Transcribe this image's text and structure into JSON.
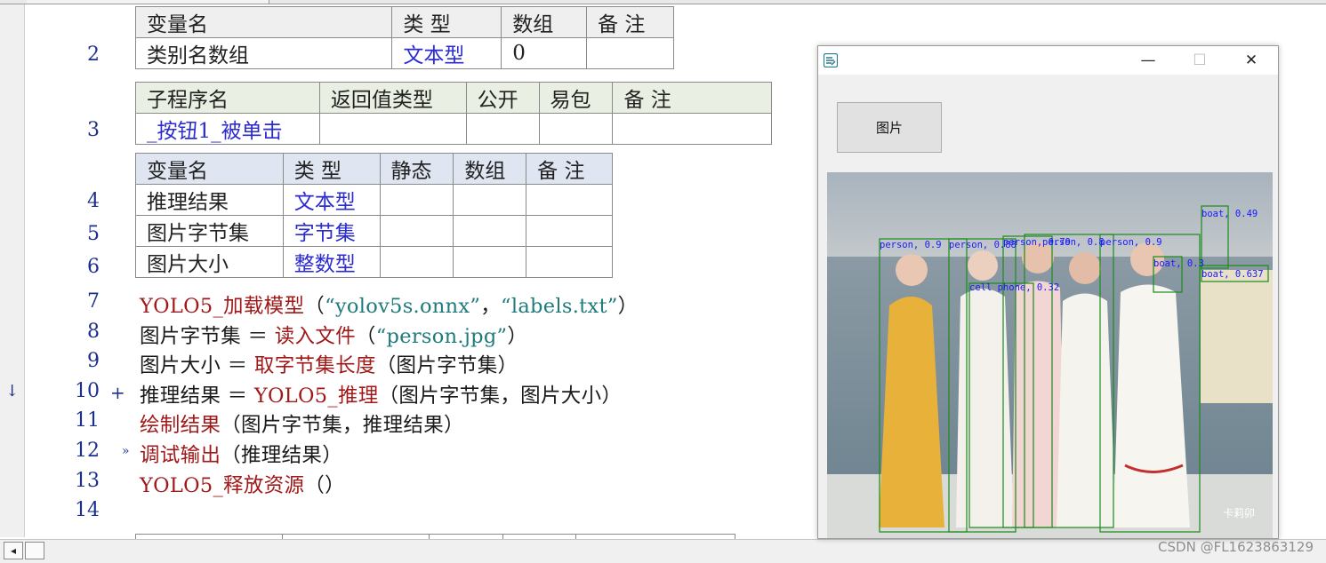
{
  "table_vars_top": {
    "headers": [
      "变量名",
      "类 型",
      "数组",
      "备 注"
    ],
    "row": [
      "类别名数组",
      "文本型",
      "0",
      ""
    ]
  },
  "table_sub": {
    "headers": [
      "子程序名",
      "返回值类型",
      "公开",
      "易包",
      "备 注"
    ],
    "row": [
      "_按钮1_被单击",
      "",
      "",
      "",
      ""
    ]
  },
  "table_locals": {
    "headers": [
      "变量名",
      "类 型",
      "静态",
      "数组",
      "备 注"
    ],
    "rows": [
      [
        "推理结果",
        "文本型",
        "",
        "",
        ""
      ],
      [
        "图片字节集",
        "字节集",
        "",
        "",
        ""
      ],
      [
        "图片大小",
        "整数型",
        "",
        "",
        ""
      ]
    ]
  },
  "line_numbers": {
    "l2": "2",
    "l3": "3",
    "l4": "4",
    "l5": "5",
    "l6": "6",
    "l7": "7",
    "l8": "8",
    "l9": "9",
    "l10": "10",
    "l11": "11",
    "l12": "12",
    "l13": "13",
    "l14": "14"
  },
  "markers": {
    "arrow": "↓",
    "plus": "+",
    "bp": "»"
  },
  "code": {
    "l7_fn": "YOLO5_加载模型",
    "l7_open": "（",
    "l7_s1": "“yolov5s.onnx”",
    "l7_sep": "，",
    "l7_s2": "“labels.txt”",
    "l7_close": "）",
    "l8_var": "图片字节集 ＝ ",
    "l8_fn": "读入文件",
    "l8_open": "（",
    "l8_s1": "“person.jpg”",
    "l8_close": "）",
    "l9_var": "图片大小 ＝ ",
    "l9_fn": "取字节集长度",
    "l9_args": "（图片字节集）",
    "l10_var": "推理结果 ＝ ",
    "l10_fn": "YOLO5_推理",
    "l10_args": "（图片字节集，图片大小）",
    "l11_fn": "绘制结果",
    "l11_args": "（图片字节集，推理结果）",
    "l12_fn": "调试输出",
    "l12_args": "（推理结果）",
    "l13_fn": "YOLO5_释放资源",
    "l13_args": "（）"
  },
  "window": {
    "min": "—",
    "max": "☐",
    "close": "✕",
    "button_label": "图片"
  },
  "detections": [
    {
      "label": "person, 0.9"
    },
    {
      "label": "person, 0.88"
    },
    {
      "label": "person, 0.79"
    },
    {
      "label": "person, 0.8"
    },
    {
      "label": "person, 0.9"
    },
    {
      "label": "cell phone, 0.32"
    },
    {
      "label": "boat, 0.49"
    },
    {
      "label": "boat, 0.3"
    },
    {
      "label": "boat, 0.637"
    }
  ],
  "photo_watermark": "卡莉卯",
  "watermark": "CSDN @FL1623863129",
  "colors": {
    "keyword_fn": "#a01818",
    "string": "#1f7a7a",
    "type_blue": "#2b2bd0",
    "line_number": "#1c2f8c",
    "box_green": "#1a8a1a",
    "label_blue": "#1a1aff"
  }
}
